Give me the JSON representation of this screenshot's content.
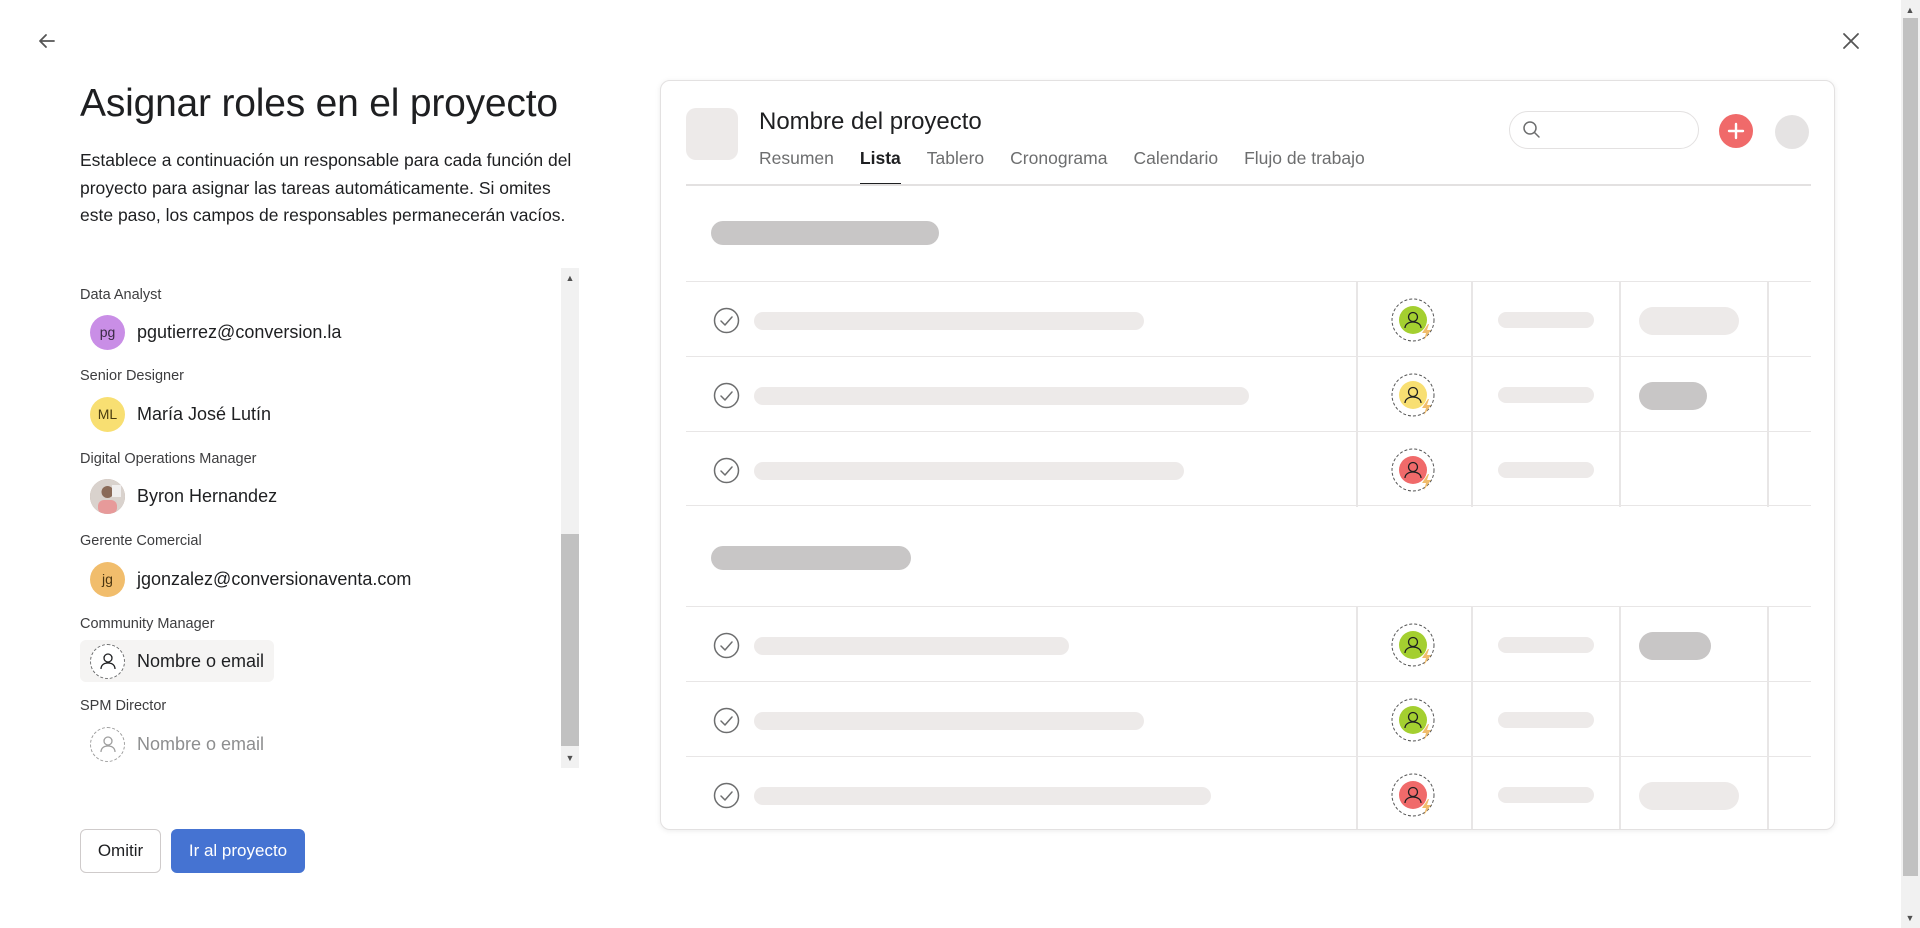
{
  "page": {
    "title": "Asignar roles en el proyecto",
    "description": "Establece a continuación un responsable para cada función del proyecto para asignar las tareas automáticamente. Si omites este paso, los campos de responsables permanecerán vacíos."
  },
  "nav": {
    "back_icon": "arrow-left-icon",
    "close_icon": "close-icon"
  },
  "roles": [
    {
      "role": "Data Analyst",
      "assignee": "pgutierrez@conversion.la",
      "initials": "pg",
      "avatar_color": "#c98ee6"
    },
    {
      "role": "Senior Designer",
      "assignee": "María José Lutín",
      "initials": "ML",
      "avatar_color": "#f8df72"
    },
    {
      "role": "Digital Operations Manager",
      "assignee": "Byron Hernandez",
      "initials": "",
      "avatar_color": "#b39b8d"
    },
    {
      "role": "Gerente Comercial",
      "assignee": "jgonzalez@conversionaventa.com",
      "initials": "jg",
      "avatar_color": "#f1bd6c"
    },
    {
      "role": "Community Manager",
      "placeholder": "Nombre o email"
    },
    {
      "role": "SPM Director",
      "placeholder": "Nombre o email"
    }
  ],
  "buttons": {
    "skip": "Omitir",
    "go": "Ir al proyecto"
  },
  "preview": {
    "project_name": "Nombre del proyecto",
    "tabs": [
      "Resumen",
      "Lista",
      "Tablero",
      "Cronograma",
      "Calendario",
      "Flujo de trabajo"
    ],
    "active_tab": "Lista",
    "colors": {
      "add_button": "#f06a6a",
      "assignee_green": "#a4cf30",
      "assignee_yellow": "#f8df72",
      "assignee_red": "#f06a6a",
      "lightning": "#f1bd6c"
    }
  }
}
